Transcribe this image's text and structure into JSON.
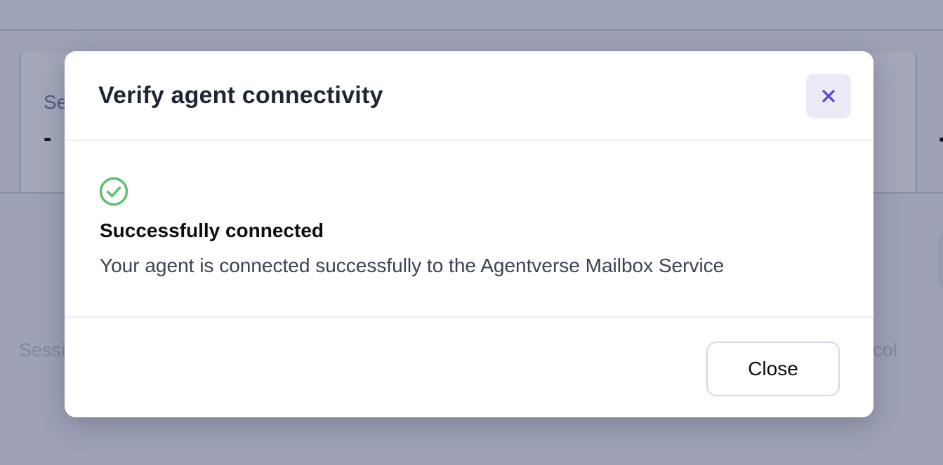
{
  "background": {
    "field_label": "Se",
    "field_value": "-",
    "table_header_left": "Sessi",
    "table_header_right": "ocol"
  },
  "modal": {
    "title": "Verify agent connectivity",
    "close_icon": "close-x-icon",
    "status": {
      "icon": "check-circle-icon",
      "title": "Successfully connected",
      "description": "Your agent is connected successfully to the Agentverse Mailbox Service"
    },
    "footer": {
      "close_label": "Close"
    }
  },
  "colors": {
    "accent": "#5b3fe0",
    "success": "#5cbf6a",
    "overlay": "rgba(40,48,92,0.42)"
  }
}
